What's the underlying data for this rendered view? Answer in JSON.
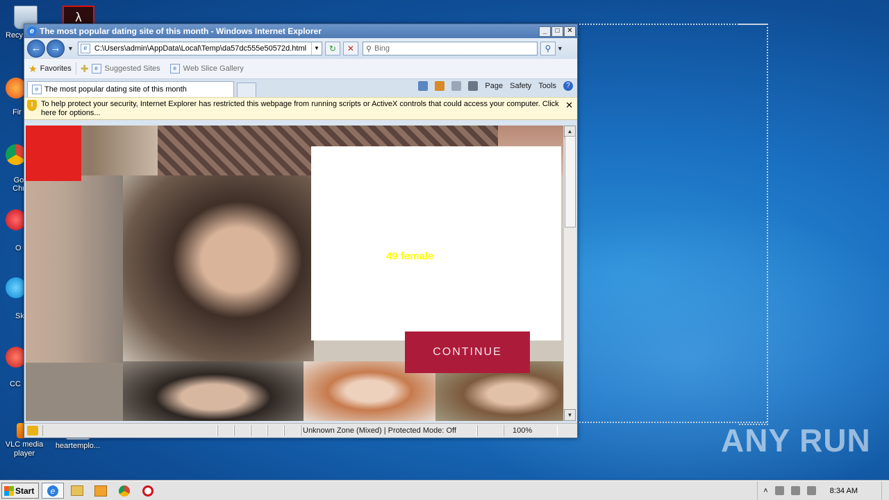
{
  "desktop": {
    "icons": {
      "recycle_bin_label": "Recy",
      "firefox_label": "Fir",
      "chrome_label": "Go Chr",
      "opera_label": "O",
      "skype_label": "Sk",
      "ccleaner_label": "CC",
      "vlc_label": "VLC media player",
      "heart_label": "heartemplo..."
    },
    "watermark": "ANY RUN"
  },
  "ie": {
    "title": "The most popular dating site of this month - Windows Internet Explorer",
    "address": "C:\\Users\\admin\\AppData\\Local\\Temp\\da57dc555e50572d.html",
    "search_placeholder": "Bing",
    "favorites_label": "Favorites",
    "suggested_sites_label": "Suggested Sites",
    "web_slice_label": "Web Slice Gallery",
    "tab_title": "The most popular dating site of this month",
    "cmd_page": "Page",
    "cmd_safety": "Safety",
    "cmd_tools": "Tools",
    "infobar_text": "To help protect your security, Internet Explorer has restricted this webpage from running scripts or ActiveX controls that could access your computer. Click here for options...",
    "status_zone": "Unknown Zone (Mixed) | Protected Mode: Off",
    "zoom": "100%"
  },
  "page": {
    "age_text": "49  female",
    "continue_label": "CONTINUE"
  },
  "taskbar": {
    "start_label": "Start",
    "clock": "8:34 AM"
  },
  "colors": {
    "continue_bg": "#ad1b3a",
    "age_text": "#ffff00",
    "red_block": "#e3211f"
  }
}
